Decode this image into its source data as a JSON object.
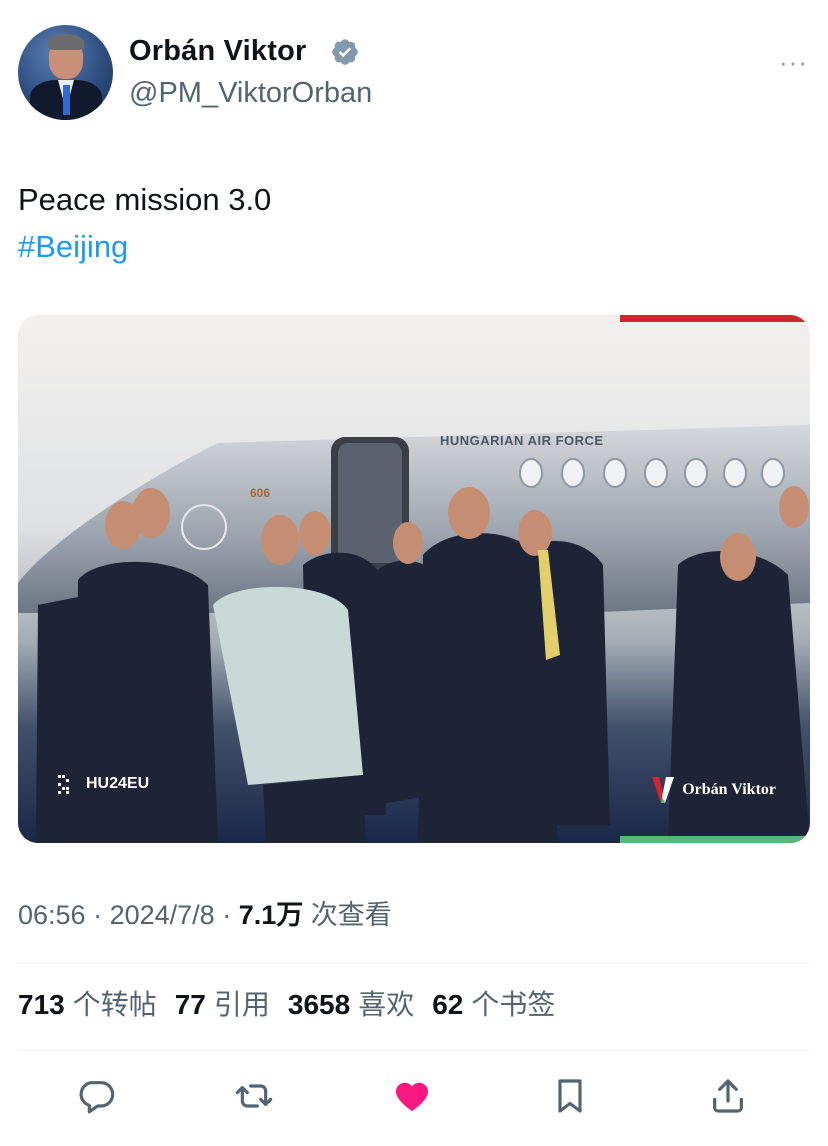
{
  "author": {
    "display_name": "Orbán Viktor",
    "handle": "@PM_ViktorOrban",
    "avatar_icon": "profile-photo",
    "verified_icon": "verified-badge-icon",
    "more_icon": "more-icon",
    "more_label": "···"
  },
  "tweet": {
    "text": "Peace mission 3.0",
    "hashtag": "#Beijing"
  },
  "media": {
    "plane_label": "HUNGARIAN AIR FORCE",
    "plane_number": "606",
    "watermark_left": "HU24EU",
    "watermark_right": "Orbán Viktor"
  },
  "meta": {
    "time": "06:56",
    "separator": " · ",
    "date": "2024/7/8",
    "views_count": "7.1万",
    "views_label": " 次查看"
  },
  "stats": {
    "reposts_count": "713",
    "reposts_label": "个转帖",
    "quotes_count": "77",
    "quotes_label": "引用",
    "likes_count": "3658",
    "likes_label": "喜欢",
    "bookmarks_count": "62",
    "bookmarks_label": "个书签"
  },
  "actions": [
    "reply-icon",
    "retweet-icon",
    "like-icon",
    "bookmark-icon",
    "share-icon"
  ],
  "colors": {
    "accent": "#1d9bf0",
    "like": "#f91880",
    "text": "#0f1419",
    "secondary": "#536471"
  }
}
